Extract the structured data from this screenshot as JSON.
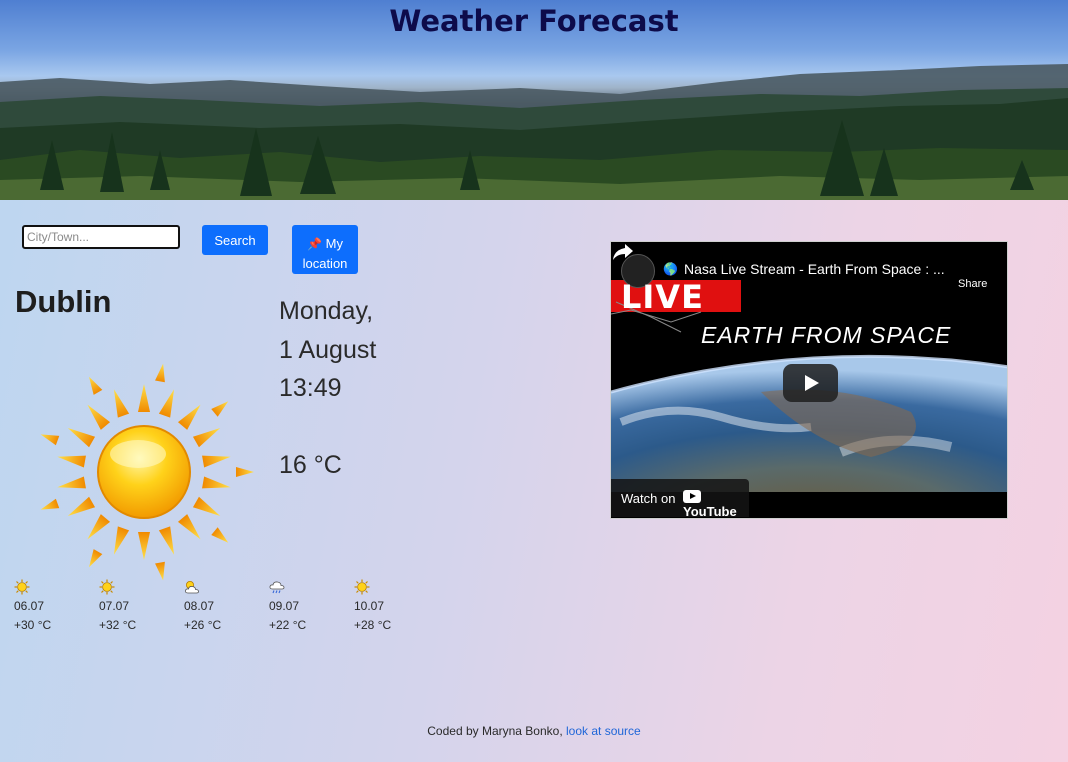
{
  "header": {
    "title": "Weather Forecast"
  },
  "search": {
    "placeholder": "City/Town...",
    "value": "",
    "search_label": "Search",
    "location_label": "My location",
    "location_icon": "pushpin-icon"
  },
  "current": {
    "city": "Dublin",
    "weekday": "Monday,",
    "date": "1 August",
    "time": "13:49",
    "temperature": "16 °C",
    "icon": "sun-icon"
  },
  "forecast": [
    {
      "icon": "sun-icon",
      "date": "06.07",
      "temp": "+30 °C"
    },
    {
      "icon": "sun-icon",
      "date": "07.07",
      "temp": "+32 °C"
    },
    {
      "icon": "partly-cloudy-icon",
      "date": "08.07",
      "temp": "+26 °C"
    },
    {
      "icon": "rain-cloud-icon",
      "date": "09.07",
      "temp": "+22 °C"
    },
    {
      "icon": "sun-icon",
      "date": "10.07",
      "temp": "+28 °C"
    }
  ],
  "video": {
    "title": "Nasa Live Stream - Earth From Space : ...",
    "share_label": "Share",
    "live_text": "LIVE",
    "overlay_text": "EARTH FROM SPACE",
    "watch_on": "Watch on",
    "platform": "YouTube"
  },
  "footer": {
    "prefix": "Coded by Maryna Bonko,",
    "link_text": "look at source"
  },
  "colors": {
    "accent": "#0d6efd",
    "title": "#0d0b4a",
    "link": "#1f66d8"
  }
}
